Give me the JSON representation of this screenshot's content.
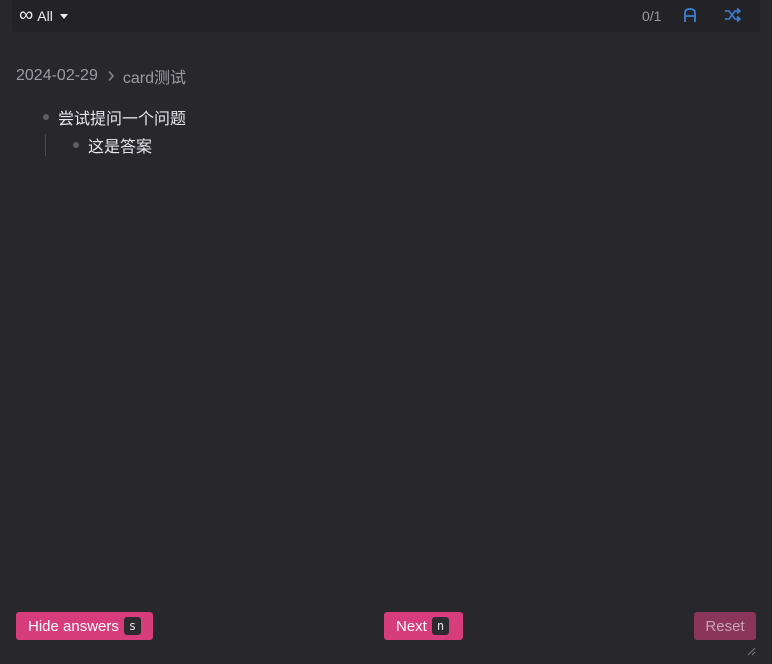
{
  "topbar": {
    "filter_icon": "infinity-icon",
    "filter_label": "All",
    "counter": "0/1",
    "font_toggle_icon": "a-letter-icon",
    "shuffle_icon": "shuffle-icon"
  },
  "breadcrumb": {
    "items": [
      "2024-02-29",
      "card测试"
    ]
  },
  "card": {
    "question": "尝试提问一个问题",
    "answer": "这是答案"
  },
  "actions": {
    "hide_answers_label": "Hide answers",
    "hide_answers_key": "s",
    "next_label": "Next",
    "next_key": "n",
    "reset_label": "Reset"
  },
  "colors": {
    "background": "#28272c",
    "accent_pink": "#d73d7c",
    "accent_blue": "#3b82d6"
  }
}
